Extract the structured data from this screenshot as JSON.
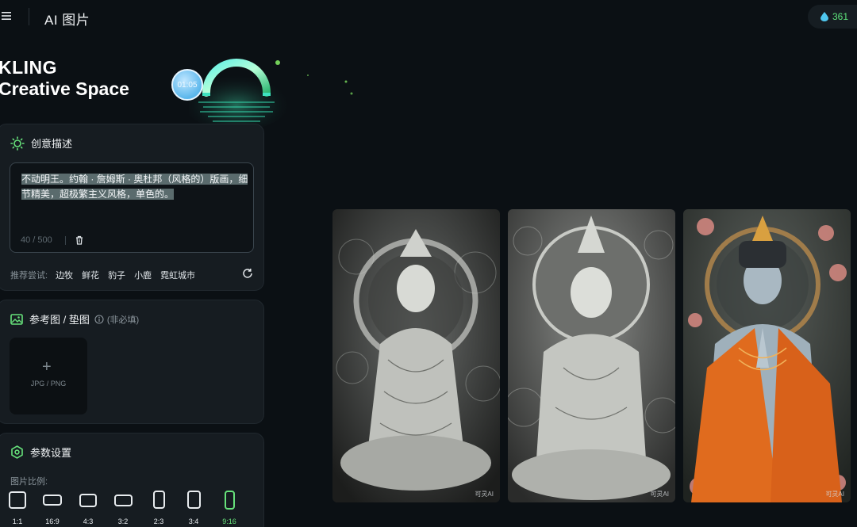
{
  "topbar": {
    "title": "AI 图片",
    "credits": "361"
  },
  "hero": {
    "brand_line1": "KLING",
    "brand_line2": "Creative Space",
    "timer": "01:05"
  },
  "prompt_panel": {
    "title": "创意描述",
    "prompt_line1": "不动明王。约翰 · 詹姆斯 · 奥杜邦（风格的）版画，细",
    "prompt_line2": "节精美，超极繁主义风格，单色的。",
    "counter": "40 / 500",
    "suggest_label": "推荐尝试:",
    "suggestions": [
      "边牧",
      "鲜花",
      "豹子",
      "小鹿",
      "霓虹城市"
    ]
  },
  "reference_panel": {
    "title": "参考图 / 垫图",
    "optional": "(非必填)",
    "upload_plus": "+",
    "upload_formats": "JPG / PNG"
  },
  "settings_panel": {
    "title": "参数设置",
    "ratio_label": "图片比例:",
    "ratios": [
      "1:1",
      "16:9",
      "4:3",
      "3:2",
      "2:3",
      "3:4",
      "9:16"
    ],
    "selected_ratio": "9:16"
  },
  "results": {
    "watermark": "可灵AI"
  },
  "colors": {
    "accent": "#67e27b",
    "background": "#0b1014",
    "panel": "#161c21"
  }
}
